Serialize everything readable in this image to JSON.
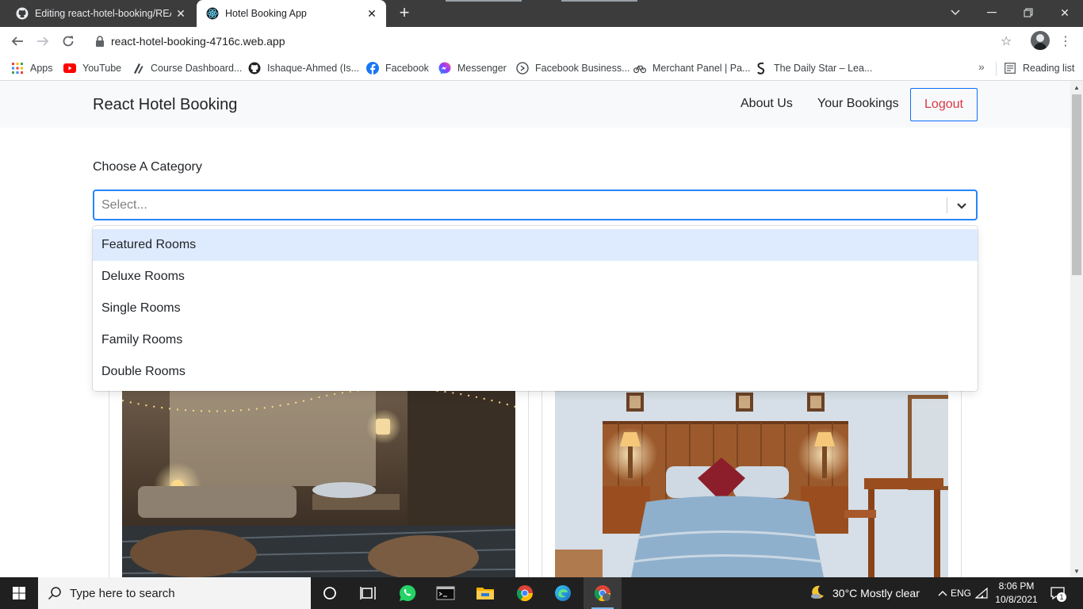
{
  "browser": {
    "tabs": [
      {
        "title": "Editing react-hotel-booking/README.md",
        "active": false,
        "icon": "github-icon"
      },
      {
        "title": "Hotel Booking App",
        "active": true,
        "icon": "react-icon"
      }
    ],
    "url": "react-hotel-booking-4716c.web.app",
    "bookmarks": [
      {
        "label": "Apps",
        "icon": "apps-grid-icon"
      },
      {
        "label": "YouTube",
        "icon": "youtube-icon"
      },
      {
        "label": "Course Dashboard...",
        "icon": "course-icon"
      },
      {
        "label": "Ishaque-Ahmed (Is...",
        "icon": "github-icon"
      },
      {
        "label": "Facebook",
        "icon": "facebook-icon"
      },
      {
        "label": "Messenger",
        "icon": "messenger-icon"
      },
      {
        "label": "Facebook Business...",
        "icon": "facebook-business-icon"
      },
      {
        "label": "Merchant Panel | Pa...",
        "icon": "bicycle-icon"
      },
      {
        "label": "The Daily Star – Lea...",
        "icon": "daily-star-icon"
      }
    ],
    "reading_list": "Reading list",
    "more_bookmarks": "»"
  },
  "app": {
    "brand": "React Hotel Booking",
    "nav": {
      "about": "About Us",
      "bookings": "Your Bookings",
      "logout": "Logout"
    },
    "category_label": "Choose A Category",
    "select": {
      "placeholder": "Select...",
      "options": [
        "Featured Rooms",
        "Deluxe Rooms",
        "Single Rooms",
        "Family Rooms",
        "Double Rooms"
      ],
      "focused_index": 0
    },
    "cards": [
      {
        "image": "outdoor-lounge-photo"
      },
      {
        "image": "bedroom-photo"
      }
    ]
  },
  "taskbar": {
    "search_placeholder": "Type here to search",
    "weather": "30°C  Mostly clear",
    "time": "8:06 PM",
    "date": "10/8/2021",
    "language": "ENG",
    "notifications": "1"
  },
  "colors": {
    "accent": "#2684ff",
    "logout_text": "#dc3545",
    "logout_border": "#0d6efd",
    "option_focus": "#deebff",
    "navbar_bg": "#f8f9fa"
  }
}
